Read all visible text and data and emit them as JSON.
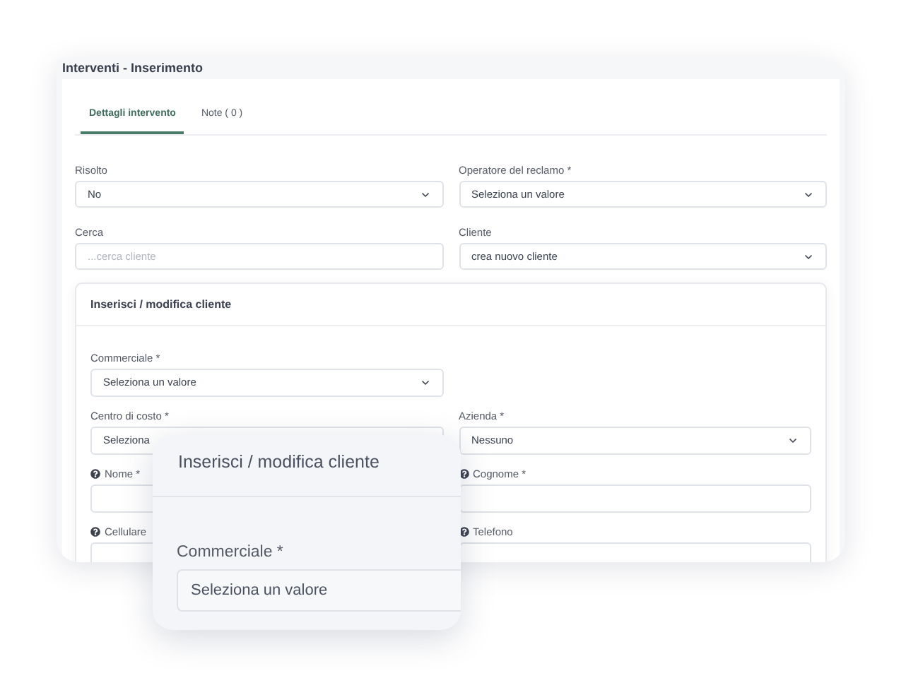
{
  "window": {
    "title": "Interventi - Inserimento"
  },
  "tabs": [
    {
      "label": "Dettagli intervento",
      "selected": true
    },
    {
      "label": "Note ( 0 )",
      "selected": false
    }
  ],
  "fields": [
    {
      "label": "Risolto",
      "kind": "select",
      "value": "No"
    },
    {
      "label": "Operatore del reclamo *",
      "kind": "select",
      "value": "Seleziona un valore"
    },
    {
      "label": "Cerca",
      "kind": "text",
      "placeholder": "...cerca cliente"
    },
    {
      "label": "Cliente",
      "kind": "select",
      "value": "crea nuovo cliente"
    }
  ],
  "client_card": {
    "title": "Inserisci / modifica cliente",
    "rows": [
      [
        {
          "label": "Commerciale *",
          "kind": "select",
          "value": "Seleziona un valore",
          "help": false
        }
      ],
      [
        {
          "label": "Centro di costo *",
          "kind": "select-partial",
          "value": "Seleziona",
          "help": false
        },
        {
          "label": "Azienda *",
          "kind": "select",
          "value": "Nessuno",
          "help": false
        }
      ],
      [
        {
          "label": "Nome *",
          "kind": "text",
          "help": true
        },
        {
          "label": "Cognome *",
          "kind": "text",
          "help": true
        }
      ],
      [
        {
          "label": "Cellulare",
          "kind": "text",
          "help": true
        },
        {
          "label": "Telefono",
          "kind": "text",
          "help": true
        }
      ]
    ]
  },
  "zoom_callout": {
    "title": "Inserisci / modifica cliente",
    "field": {
      "label": "Commerciale *",
      "value": "Seleziona un valore"
    }
  }
}
